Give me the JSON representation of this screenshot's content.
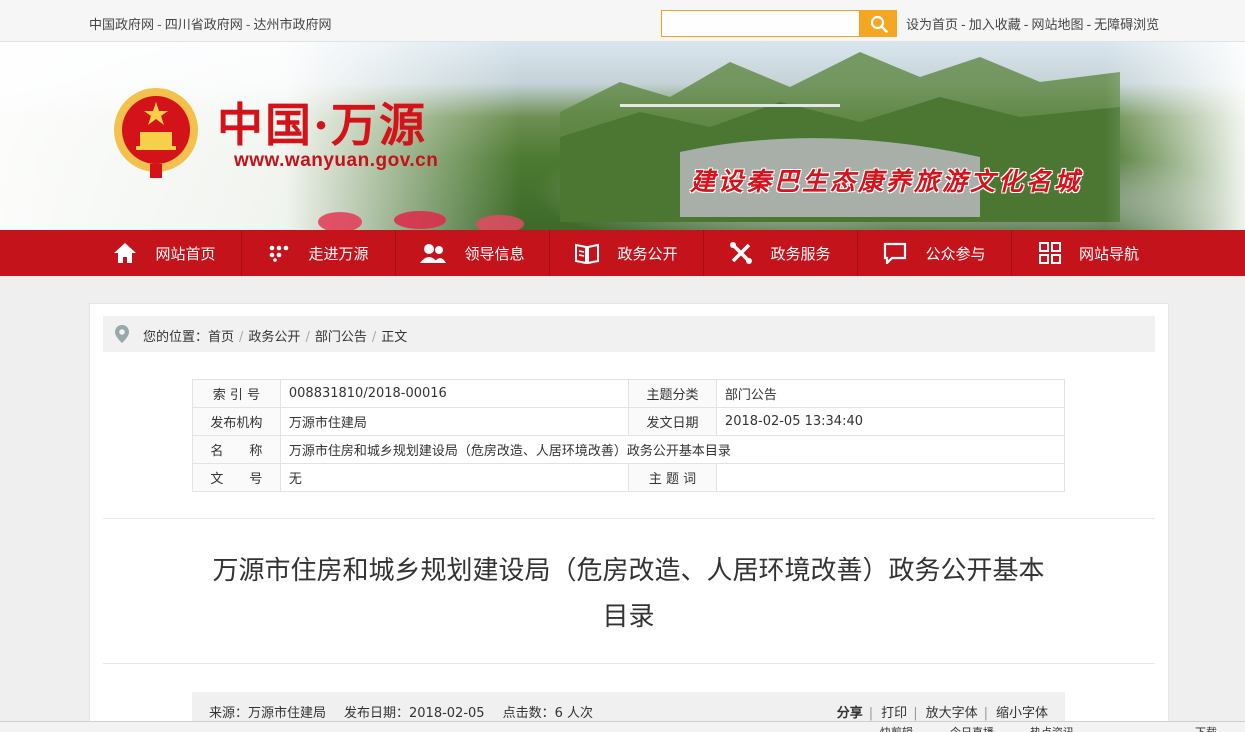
{
  "top": {
    "links": [
      "中国政府网",
      "四川省政府网",
      "达州市政府网"
    ],
    "search_placeholder": "",
    "right_links": [
      "设为首页",
      "加入收藏",
      "网站地图",
      "无障碍浏览"
    ]
  },
  "banner": {
    "site_name": "中国·万源",
    "url": "www.wanyuan.gov.cn",
    "slogan": "建设秦巴生态康养旅游文化名城"
  },
  "nav": [
    "网站首页",
    "走进万源",
    "领导信息",
    "政务公开",
    "政务服务",
    "公众参与",
    "网站导航"
  ],
  "breadcrumb": {
    "label": "您的位置：",
    "items": [
      "首页",
      "政务公开",
      "部门公告",
      "正文"
    ]
  },
  "meta": {
    "index_label": "索 引 号",
    "index_value": "008831810/2018-00016",
    "topic_label": "主题分类",
    "topic_value": "部门公告",
    "org_label": "发布机构",
    "org_value": "万源市住建局",
    "date_label": "发文日期",
    "date_value": "2018-02-05 13:34:40",
    "name_label": "名　　称",
    "name_value": "万源市住房和城乡规划建设局（危房改造、人居环境改善）政务公开基本目录",
    "docno_label": "文　　号",
    "docno_value": "无",
    "keywords_label": "主 题 词",
    "keywords_value": ""
  },
  "article": {
    "title_line1": "万源市住房和城乡规划建设局（危房改造、人居环境改善）政务公开基本",
    "title_line2": "目录"
  },
  "info": {
    "source": "来源：万源市住建局",
    "date": "发布日期：2018-02-05",
    "clicks": "点击数：6 人次",
    "share": "分享",
    "print": "打印",
    "enlarge": "放大字体",
    "shrink": "缩小字体"
  },
  "statusbar": {
    "items": [
      "快剪辑",
      "今日直播",
      "热点资讯",
      "下载"
    ]
  },
  "colors": {
    "nav_red": "#c5131c",
    "title_red": "#d4121a",
    "search_orange": "#f5a623"
  }
}
